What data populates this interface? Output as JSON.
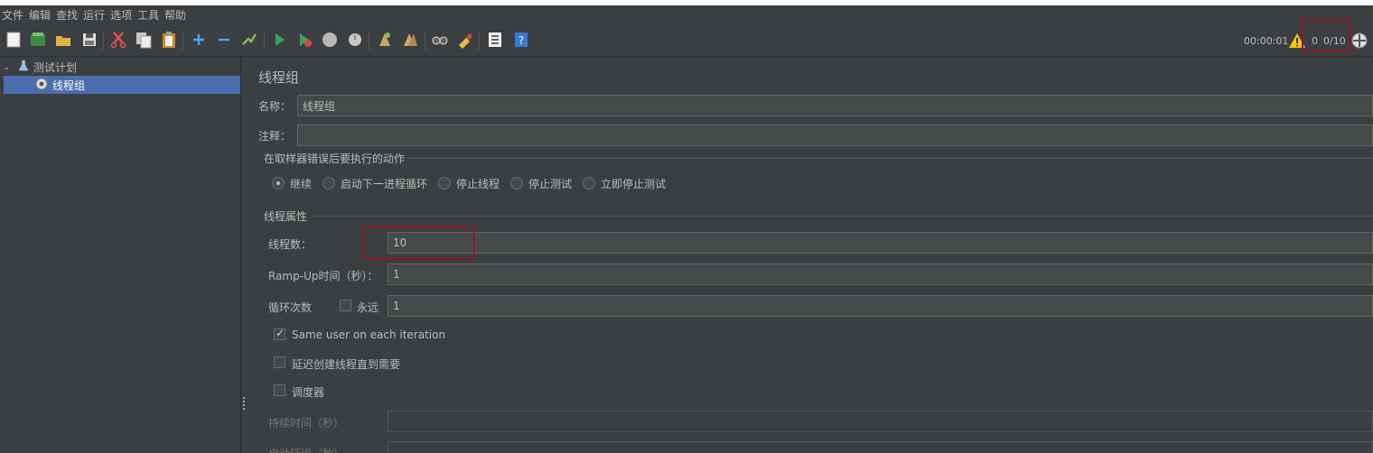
{
  "menu": [
    "文件",
    "编辑",
    "查找",
    "运行",
    "选项",
    "工具",
    "帮助"
  ],
  "status": {
    "timer": "00:00:01",
    "errors": "0",
    "threads": "0/10"
  },
  "tree": {
    "root": "测试计划",
    "child": "线程组"
  },
  "panel": {
    "title": "线程组",
    "name_label": "名称：",
    "name_value": "线程组",
    "comment_label": "注释：",
    "comment_value": "",
    "error_group_title": "在取样器错误后要执行的动作",
    "error_actions": [
      "继续",
      "启动下一进程循环",
      "停止线程",
      "停止测试",
      "立即停止测试"
    ],
    "selected_action": "继续",
    "props_title": "线程属性",
    "threads_label": "线程数：",
    "threads_value": "10",
    "rampup_label": "Ramp-Up时间（秒）：",
    "rampup_value": "1",
    "loop_label": "循环次数",
    "forever_label": "永远",
    "forever_checked": false,
    "loop_value": "1",
    "same_user_label": "Same user on each iteration",
    "same_user_checked": true,
    "delay_label": "延迟创建线程直到需要",
    "delay_checked": false,
    "scheduler_label": "调度器",
    "scheduler_checked": false,
    "duration_label": "持续时间（秒）",
    "duration_value": "",
    "startup_delay_label": "启动延迟（秒）",
    "startup_delay_value": ""
  }
}
